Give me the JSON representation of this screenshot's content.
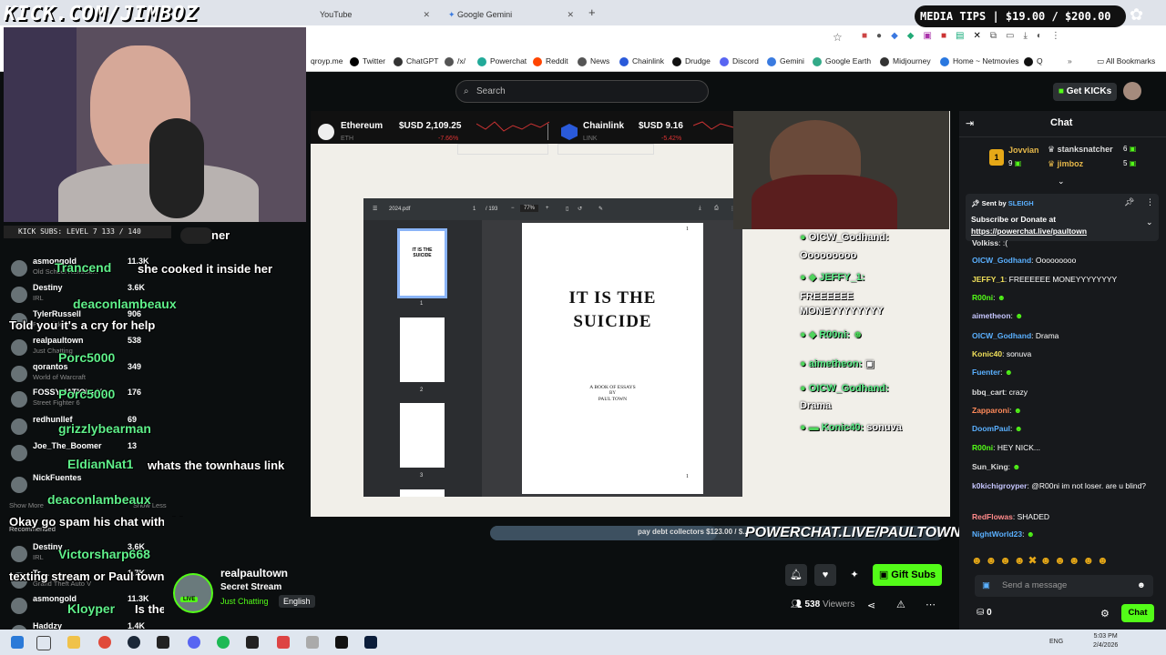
{
  "overlay_header": "KICK.COM/JIMBOZ",
  "media_tips": "MEDIA TIPS | $19.00 / $200.00",
  "kick_subs": "KICK SUBS: LEVEL 7 133 / 140",
  "browser": {
    "tabs": [
      "YouTube",
      "Google Gemini"
    ],
    "bookmarks": [
      "Twitter",
      "ChatGPT",
      "/x/",
      "Powerchat",
      "Reddit",
      "News",
      "Chainlink",
      "Drudge",
      "Discord",
      "Gemini",
      "Google Earth",
      "Midjourney",
      "Home ~ Netmovies",
      "Q"
    ],
    "bookmark_partial": "qroyp.me",
    "all_bookmarks": "All Bookmarks"
  },
  "search": {
    "placeholder": "Search"
  },
  "get_kicks": "Get KICKs",
  "ticker": {
    "eth_name": "Ethereum",
    "eth_symbol": "ETH",
    "eth_price": "$USD 2,109.25",
    "eth_change": "-7.66%",
    "link_name": "Chainlink",
    "link_symbol": "LINK",
    "link_price": "$USD 9.16",
    "link_change": "-5.42%"
  },
  "pdf": {
    "filename": "2024.pdf",
    "page": "1",
    "total": "/ 193",
    "zoom": "77%",
    "title_line1": "IT IS THE",
    "title_line2": "SUICIDE",
    "subtitle": "A BOOK OF ESSAYS",
    "by": "BY",
    "author": "PAUL TOWN",
    "thumb_numbers": [
      "1",
      "2",
      "3"
    ]
  },
  "overlay_chat": [
    {
      "user": "OICW_Godhand:",
      "text": "Ooooooooo"
    },
    {
      "user": "JEFFY_1:",
      "text": "FREEEEEE MONEYYYYYYYY"
    },
    {
      "user": "R00ni:",
      "text": ""
    },
    {
      "user": "aimetheon:",
      "text": ""
    },
    {
      "user": "OICW_Godhand:",
      "text": "Drama"
    },
    {
      "user": "Konic40:",
      "text": "sonuva"
    }
  ],
  "sidebar": [
    {
      "name": "asmongold",
      "sub": "Old School RuneSc...",
      "count": "11.3K"
    },
    {
      "name": "Destiny",
      "sub": "IRL",
      "count": "3.6K"
    },
    {
      "name": "TylerRussell",
      "sub": "PC Builders",
      "count": "906"
    },
    {
      "name": "realpaultown",
      "sub": "Just Chatting",
      "count": "538"
    },
    {
      "name": "qorantos",
      "sub": "World of Warcraft",
      "count": "349"
    },
    {
      "name": "FOSSYNATION-AL",
      "sub": "Street Fighter 6",
      "count": "176"
    },
    {
      "name": "redhunllef",
      "sub": "",
      "count": "69"
    },
    {
      "name": "Joe_The_Boomer",
      "sub": "",
      "count": "13"
    },
    {
      "name": "NickFuentes",
      "sub": "",
      "count": ""
    },
    {
      "name": "Destiny",
      "sub": "IRL",
      "count": "3.6K"
    },
    {
      "name": "Tr....",
      "sub": "Grand Theft Auto V",
      "count": "1.7K"
    },
    {
      "name": "asmongold",
      "sub": "",
      "count": "11.3K"
    },
    {
      "name": "Haddzy",
      "sub": "",
      "count": "1.4K"
    }
  ],
  "sidebar_show_more": "Show More",
  "sidebar_show_less": "Show Less",
  "sidebar_recommended": "Recommended",
  "overlay_messages": [
    {
      "user": "Trancend",
      "text": "she cooked it inside her"
    },
    {
      "user": "deaconlambeaux",
      "text": "Told you it's a cry for help"
    },
    {
      "user": "Porc5000",
      "text": ""
    },
    {
      "user": "Porc5000",
      "text": ""
    },
    {
      "user": "grizzlybearman",
      "text": ""
    },
    {
      "user": "EldianNat1",
      "text": "whats the townhaus link"
    },
    {
      "user": "deaconlambeaux",
      "text": "Okay go spam his chat with this new emote"
    },
    {
      "user": "Victorsharp668",
      "text": "texting stream or Paul town reaction stream"
    },
    {
      "user": "Kloyper",
      "text": "Is the book available?"
    }
  ],
  "overlay_partial": "ner",
  "stream": {
    "streamer": "realpaultown",
    "title": "Secret Stream",
    "category": "Just Chatting",
    "language": "English",
    "viewers": "538",
    "viewers_label": "Viewers",
    "gift_subs": "Gift Subs"
  },
  "powerchat": {
    "bar_text": "pay debt collectors $123.00 / $...",
    "link": "POWERCHAT.LIVE/PAULTOWN"
  },
  "chat": {
    "title": "Chat",
    "top_gifters": [
      {
        "name": "Jovvian",
        "count": "9"
      },
      {
        "name": "stanksnatcher",
        "count": "6"
      },
      {
        "name": "jimboz",
        "count": "5"
      }
    ],
    "pinned_by_label": "Sent by",
    "pinned_by": "SLEIGH",
    "pinned_text": "Subscribe or Donate at",
    "pinned_link": "https://powerchat.live/paultown",
    "messages": [
      {
        "user": "Volkiss",
        "text": ":("
      },
      {
        "user": "OICW_Godhand",
        "text": "Ooooooooo"
      },
      {
        "user": "JEFFY_1",
        "text": "FREEEEEE MONEYYYYYYYY"
      },
      {
        "user": "R00ni",
        "text": ""
      },
      {
        "user": "aimetheon",
        "text": ""
      },
      {
        "user": "OICW_Godhand",
        "text": "Drama"
      },
      {
        "user": "Konic40",
        "text": "sonuva"
      },
      {
        "user": "Fuenter",
        "text": ""
      },
      {
        "user": "bbq_cart",
        "text": "crazy"
      },
      {
        "user": "Zapparoni",
        "text": ""
      },
      {
        "user": "DoomPaul",
        "text": ""
      },
      {
        "user": "R00ni",
        "text": "HEY NICK..."
      },
      {
        "user": "Sun_King",
        "text": ""
      },
      {
        "user": "k0kichigroyper",
        "text": "@R00ni im not loser. are u blind?"
      },
      {
        "user": "RedFlowas",
        "text": "SHADED"
      },
      {
        "user": "NightWorld23",
        "text": ""
      }
    ],
    "send_placeholder": "Send a message",
    "points": "0",
    "chat_button": "Chat"
  },
  "taskbar": {
    "lang": "ENG",
    "time": "5:03 PM",
    "date": "2/4/2026"
  },
  "colors": {
    "kick_green": "#53fc18",
    "chat_bg": "#17191c",
    "page_bg": "#0b0e0f"
  }
}
